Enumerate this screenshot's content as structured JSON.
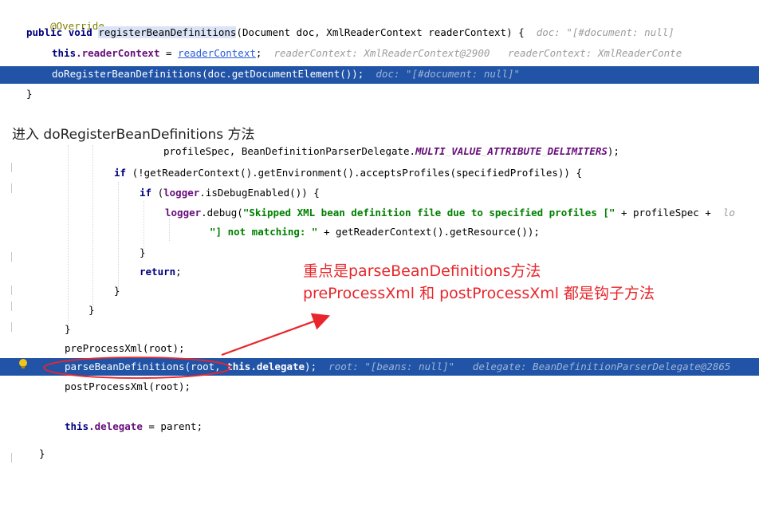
{
  "snippet1": {
    "override": "@Override",
    "sig_public": "public",
    "sig_void": "void",
    "sig_method": "registerBeanDefinitions",
    "sig_params": "(Document doc, XmlReaderContext readerContext) {",
    "sig_hint": "doc: \"[#document: null]",
    "l2_this": "this",
    "l2_field": ".readerContext",
    "l2_eq": " = ",
    "l2_value": "readerContext",
    "l2_semi": ";",
    "l2_hint": "readerContext: XmlReaderContext@2900   readerContext: XmlReaderConte",
    "l3_code": "doRegisterBeanDefinitions(doc.getDocumentElement());",
    "l3_hint": "doc: \"[#document: null]\"",
    "close": "}"
  },
  "heading": "进入 doRegisterBeanDefinitions 方法",
  "snippet2": {
    "l0": "profileSpec, BeanDefinitionParserDelegate.",
    "l0_const": "MULTI_VALUE_ATTRIBUTE_DELIMITERS",
    "l0_end": ");",
    "l1_if": "if",
    "l1_code": " (!getReaderContext().getEnvironment().acceptsProfiles(specifiedProfiles)) {",
    "l2_if": "if",
    "l2_pre": " (",
    "l2_logger": "logger",
    "l2_post": ".isDebugEnabled()) {",
    "l3_logger": "logger",
    "l3_pre": ".debug(",
    "l3_str": "\"Skipped XML bean definition file due to specified profiles [\"",
    "l3_post": " + profileSpec +  ",
    "l3_hint": "lo",
    "l4_str": "\"] not matching: \"",
    "l4_post": " + getReaderContext().getResource());",
    "l5": "}",
    "l6_return": "return",
    "l6_semi": ";",
    "l7": "}",
    "l8": "}",
    "l9": "}",
    "l10": "preProcessXml(root);",
    "l11_code": "parseBeanDefinitions(root, ",
    "l11_this": "this",
    "l11_field": ".delegate",
    "l11_end": ");",
    "l11_hint": "root: \"[beans: null]\"   delegate: BeanDefinitionParserDelegate@2865",
    "l12": "postProcessXml(root);",
    "l14_this": "this",
    "l14_field": ".delegate",
    "l14_end": " = parent;",
    "l15": "}"
  },
  "callout": {
    "line1": "重点是parseBeanDefinitions方法",
    "line2": "preProcessXml 和 postProcessXml 都是钩子方法"
  },
  "colors": {
    "highlight": "#2154a6",
    "callout": "#e8262b",
    "keyword": "#000080",
    "field": "#660e7a",
    "string": "#008000"
  }
}
